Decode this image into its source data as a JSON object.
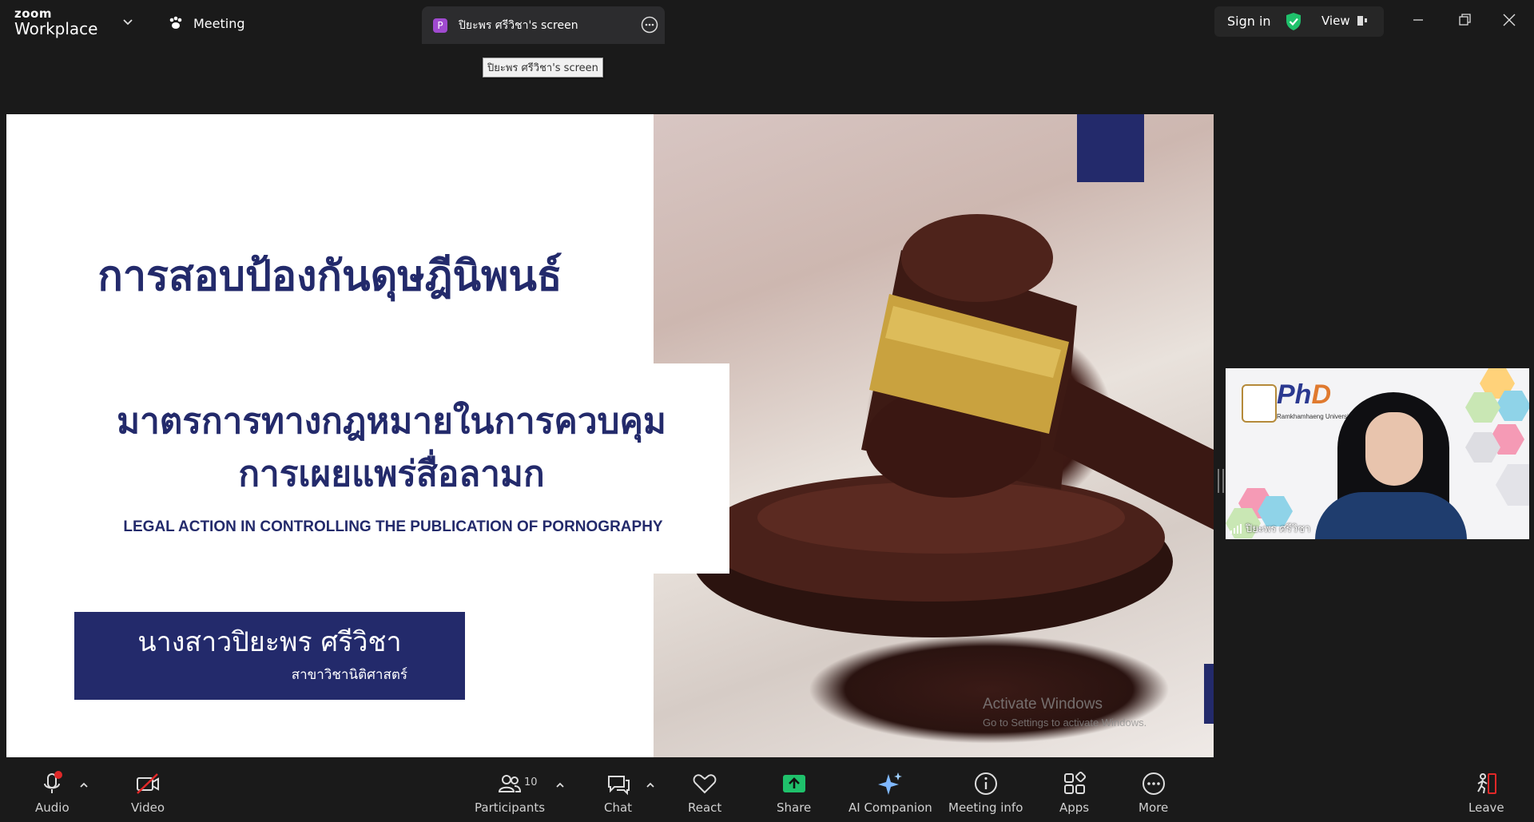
{
  "app": {
    "logo_line1": "zoom",
    "logo_line2": "Workplace"
  },
  "tabs": {
    "meeting": "Meeting",
    "share_badge": "P",
    "share_title": "ปิยะพร ศรีวิชา's screen",
    "tooltip": "ปิยะพร ศรีวิชา's screen"
  },
  "header": {
    "sign_in": "Sign in",
    "view": "View"
  },
  "slide": {
    "title": "การสอบป้องกันดุษฎีนิพนธ์",
    "subtitle_line1": "มาตรการทางกฎหมายในการควบคุม",
    "subtitle_line2": "การเผยแพร่สื่อลามก",
    "english_title": "LEGAL ACTION IN CONTROLLING THE PUBLICATION OF PORNOGRAPHY",
    "presenter_name": "นางสาวปิยะพร ศรีวิชา",
    "department": "สาขาวิชานิติศาสตร์"
  },
  "watermark": {
    "line1": "Activate Windows",
    "line2": "Go to Settings to activate Windows."
  },
  "video": {
    "participant_name": "ปิยะพร ศรีวิชา",
    "logo_text": "PhD",
    "university": "Ramkhamhaeng University"
  },
  "toolbar": {
    "audio": "Audio",
    "video": "Video",
    "participants": "Participants",
    "participants_count": "10",
    "chat": "Chat",
    "react": "React",
    "share": "Share",
    "ai_companion": "AI Companion",
    "meeting_info": "Meeting info",
    "apps": "Apps",
    "more": "More",
    "leave": "Leave"
  },
  "colors": {
    "navy": "#232a6b",
    "share_green": "#1fc16b",
    "shield_green": "#1fc16b",
    "leave_red": "#e02828",
    "badge_purple": "#a04ad0"
  }
}
